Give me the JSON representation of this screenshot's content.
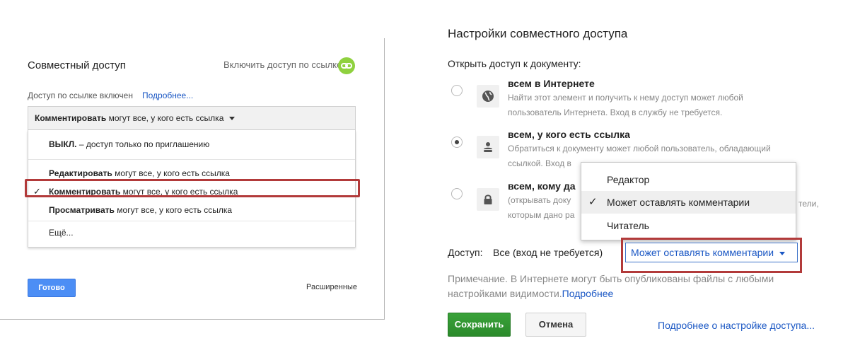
{
  "left": {
    "title": "Совместный доступ",
    "link_toggle_label": "Включить доступ по ссылке",
    "link_status": "Доступ по ссылке включен",
    "more_link": "Подробнее...",
    "selected": {
      "bold": "Комментировать",
      "rest": " могут все, у кого есть ссылка"
    },
    "menu": {
      "off": {
        "bold": "ВЫКЛ.",
        "rest": " – доступ только по приглашению"
      },
      "edit": {
        "bold": "Редактировать",
        "rest": " могут все, у кого есть ссылка"
      },
      "comment": {
        "bold": "Комментировать",
        "rest": " могут все, у кого есть ссылка"
      },
      "view": {
        "bold": "Просматривать",
        "rest": " могут все, у кого есть ссылка"
      },
      "more": "Ещё..."
    },
    "check_mark": "✓",
    "done_button": "Готово",
    "advanced_link": "Расширенные"
  },
  "right": {
    "title": "Настройки совместного доступа",
    "open_access_label": "Открыть доступ к документу:",
    "options": [
      {
        "title": "всем в Интернете",
        "desc_1": "Найти этот элемент и получить к нему доступ может любой",
        "desc_2": "пользователь Интернета. Вход в службу не требуется.",
        "checked": false
      },
      {
        "title": "всем, у кого есть ссылка",
        "desc_1": "Обратиться к документу может любой пользователь, обладающий",
        "desc_2": "ссылкой. Вход в",
        "checked": true
      },
      {
        "title": "всем, кому да",
        "desc_1": "(открывать доку",
        "desc_1_tail": "тели,",
        "desc_2": "которым дано ра",
        "checked": false
      }
    ],
    "dropdown": {
      "items": [
        "Редактор",
        "Может оставлять комментарии",
        "Читатель"
      ],
      "selected_index": 1,
      "check_mark": "✓"
    },
    "access_label": "Доступ:",
    "access_value": "Все (вход не требуется)",
    "access_select": "Может оставлять комментарии",
    "note_text": "Примечание. В Интернете могут быть опубликованы файлы с любыми настройками видимости.",
    "note_link": "Подробнее",
    "save_button": "Сохранить",
    "cancel_button": "Отмена",
    "more_settings_link": "Подробнее о настройке доступа..."
  },
  "colors": {
    "accent_blue": "#4c8ef5",
    "link_blue": "#1a57c4",
    "save_green": "#2b8a2b",
    "highlight_red": "#b23a3a",
    "link_icon_green": "#8fd13f"
  }
}
